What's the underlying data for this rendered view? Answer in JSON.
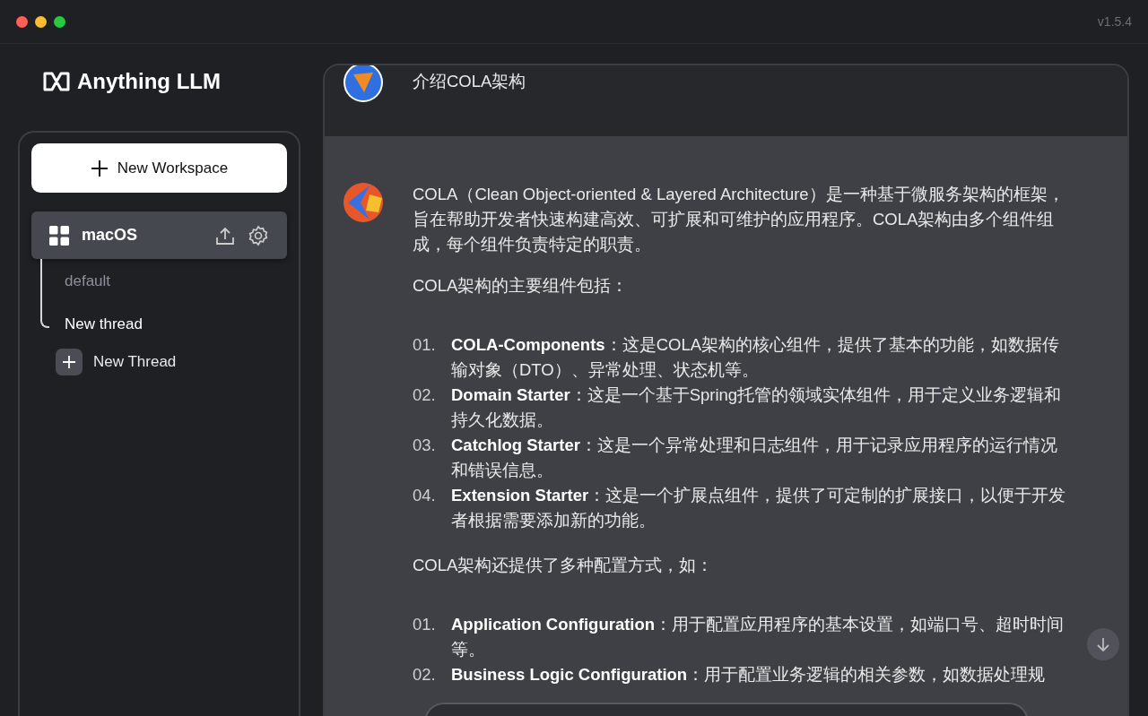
{
  "window": {
    "version": "v1.5.4"
  },
  "sidebar": {
    "brand": "Anything LLM",
    "new_workspace": "New Workspace",
    "workspaces": [
      {
        "name": "macOS",
        "selected": true,
        "threads": [
          {
            "title": "default",
            "selected": false
          },
          {
            "title": "New thread",
            "selected": true
          }
        ],
        "new_thread": "New Thread"
      }
    ]
  },
  "chat": {
    "messages": [
      {
        "kind": "user",
        "blocks": [
          {
            "kind": "paragraph",
            "text": "介绍COLA架构"
          }
        ]
      },
      {
        "kind": "assistant",
        "blocks": [
          {
            "kind": "paragraph",
            "text": "COLA（Clean Object-oriented & Layered Architecture）是一种基于微服务架构的框架，旨在帮助开发者快速构建高效、可扩展和可维护的应用程序。COLA架构由多个组件组成，每个组件负责特定的职责。"
          },
          {
            "kind": "paragraph",
            "text": "COLA架构的主要组件包括："
          },
          {
            "kind": "list",
            "items": [
              {
                "number": "01.",
                "text": "**COLA-Components**：这是COLA架构的核心组件，提供了基本的功能，如数据传输对象（DTO）、异常处理、状态机等。"
              },
              {
                "number": "02.",
                "text": "**Domain Starter**：这是一个基于Spring托管的领域实体组件，用于定义业务逻辑和持久化数据。"
              },
              {
                "number": "03.",
                "text": "**Catchlog Starter**：这是一个异常处理和日志组件，用于记录应用程序的运行情况和错误信息。"
              },
              {
                "number": "04.",
                "text": "**Extension Starter**：这是一个扩展点组件，提供了可定制的扩展接口，以便于开发者根据需要添加新的功能。"
              }
            ]
          },
          {
            "kind": "paragraph",
            "text": "COLA架构还提供了多种配置方式，如："
          },
          {
            "kind": "list",
            "items": [
              {
                "number": "01.",
                "text": "**Application Configuration**：用于配置应用程序的基本设置，如端口号、超时时间等。"
              },
              {
                "number": "02.",
                "text": "**Business Logic Configuration**：用于配置业务逻辑的相关参数，如数据处理规"
              }
            ]
          }
        ]
      }
    ]
  }
}
